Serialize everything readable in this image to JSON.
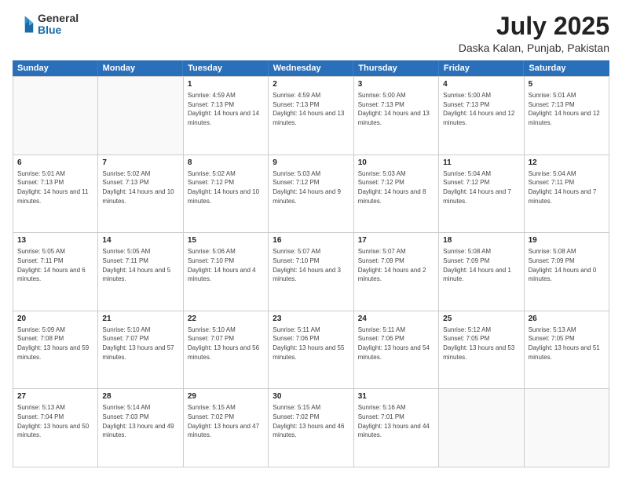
{
  "header": {
    "logo": {
      "general": "General",
      "blue": "Blue"
    },
    "title": "July 2025",
    "location": "Daska Kalan, Punjab, Pakistan"
  },
  "days_of_week": [
    "Sunday",
    "Monday",
    "Tuesday",
    "Wednesday",
    "Thursday",
    "Friday",
    "Saturday"
  ],
  "weeks": [
    [
      {
        "day": "",
        "empty": true
      },
      {
        "day": "",
        "empty": true
      },
      {
        "day": "1",
        "sunrise": "Sunrise: 4:59 AM",
        "sunset": "Sunset: 7:13 PM",
        "daylight": "Daylight: 14 hours and 14 minutes."
      },
      {
        "day": "2",
        "sunrise": "Sunrise: 4:59 AM",
        "sunset": "Sunset: 7:13 PM",
        "daylight": "Daylight: 14 hours and 13 minutes."
      },
      {
        "day": "3",
        "sunrise": "Sunrise: 5:00 AM",
        "sunset": "Sunset: 7:13 PM",
        "daylight": "Daylight: 14 hours and 13 minutes."
      },
      {
        "day": "4",
        "sunrise": "Sunrise: 5:00 AM",
        "sunset": "Sunset: 7:13 PM",
        "daylight": "Daylight: 14 hours and 12 minutes."
      },
      {
        "day": "5",
        "sunrise": "Sunrise: 5:01 AM",
        "sunset": "Sunset: 7:13 PM",
        "daylight": "Daylight: 14 hours and 12 minutes."
      }
    ],
    [
      {
        "day": "6",
        "sunrise": "Sunrise: 5:01 AM",
        "sunset": "Sunset: 7:13 PM",
        "daylight": "Daylight: 14 hours and 11 minutes."
      },
      {
        "day": "7",
        "sunrise": "Sunrise: 5:02 AM",
        "sunset": "Sunset: 7:13 PM",
        "daylight": "Daylight: 14 hours and 10 minutes."
      },
      {
        "day": "8",
        "sunrise": "Sunrise: 5:02 AM",
        "sunset": "Sunset: 7:12 PM",
        "daylight": "Daylight: 14 hours and 10 minutes."
      },
      {
        "day": "9",
        "sunrise": "Sunrise: 5:03 AM",
        "sunset": "Sunset: 7:12 PM",
        "daylight": "Daylight: 14 hours and 9 minutes."
      },
      {
        "day": "10",
        "sunrise": "Sunrise: 5:03 AM",
        "sunset": "Sunset: 7:12 PM",
        "daylight": "Daylight: 14 hours and 8 minutes."
      },
      {
        "day": "11",
        "sunrise": "Sunrise: 5:04 AM",
        "sunset": "Sunset: 7:12 PM",
        "daylight": "Daylight: 14 hours and 7 minutes."
      },
      {
        "day": "12",
        "sunrise": "Sunrise: 5:04 AM",
        "sunset": "Sunset: 7:11 PM",
        "daylight": "Daylight: 14 hours and 7 minutes."
      }
    ],
    [
      {
        "day": "13",
        "sunrise": "Sunrise: 5:05 AM",
        "sunset": "Sunset: 7:11 PM",
        "daylight": "Daylight: 14 hours and 6 minutes."
      },
      {
        "day": "14",
        "sunrise": "Sunrise: 5:05 AM",
        "sunset": "Sunset: 7:11 PM",
        "daylight": "Daylight: 14 hours and 5 minutes."
      },
      {
        "day": "15",
        "sunrise": "Sunrise: 5:06 AM",
        "sunset": "Sunset: 7:10 PM",
        "daylight": "Daylight: 14 hours and 4 minutes."
      },
      {
        "day": "16",
        "sunrise": "Sunrise: 5:07 AM",
        "sunset": "Sunset: 7:10 PM",
        "daylight": "Daylight: 14 hours and 3 minutes."
      },
      {
        "day": "17",
        "sunrise": "Sunrise: 5:07 AM",
        "sunset": "Sunset: 7:09 PM",
        "daylight": "Daylight: 14 hours and 2 minutes."
      },
      {
        "day": "18",
        "sunrise": "Sunrise: 5:08 AM",
        "sunset": "Sunset: 7:09 PM",
        "daylight": "Daylight: 14 hours and 1 minute."
      },
      {
        "day": "19",
        "sunrise": "Sunrise: 5:08 AM",
        "sunset": "Sunset: 7:09 PM",
        "daylight": "Daylight: 14 hours and 0 minutes."
      }
    ],
    [
      {
        "day": "20",
        "sunrise": "Sunrise: 5:09 AM",
        "sunset": "Sunset: 7:08 PM",
        "daylight": "Daylight: 13 hours and 59 minutes."
      },
      {
        "day": "21",
        "sunrise": "Sunrise: 5:10 AM",
        "sunset": "Sunset: 7:07 PM",
        "daylight": "Daylight: 13 hours and 57 minutes."
      },
      {
        "day": "22",
        "sunrise": "Sunrise: 5:10 AM",
        "sunset": "Sunset: 7:07 PM",
        "daylight": "Daylight: 13 hours and 56 minutes."
      },
      {
        "day": "23",
        "sunrise": "Sunrise: 5:11 AM",
        "sunset": "Sunset: 7:06 PM",
        "daylight": "Daylight: 13 hours and 55 minutes."
      },
      {
        "day": "24",
        "sunrise": "Sunrise: 5:11 AM",
        "sunset": "Sunset: 7:06 PM",
        "daylight": "Daylight: 13 hours and 54 minutes."
      },
      {
        "day": "25",
        "sunrise": "Sunrise: 5:12 AM",
        "sunset": "Sunset: 7:05 PM",
        "daylight": "Daylight: 13 hours and 53 minutes."
      },
      {
        "day": "26",
        "sunrise": "Sunrise: 5:13 AM",
        "sunset": "Sunset: 7:05 PM",
        "daylight": "Daylight: 13 hours and 51 minutes."
      }
    ],
    [
      {
        "day": "27",
        "sunrise": "Sunrise: 5:13 AM",
        "sunset": "Sunset: 7:04 PM",
        "daylight": "Daylight: 13 hours and 50 minutes."
      },
      {
        "day": "28",
        "sunrise": "Sunrise: 5:14 AM",
        "sunset": "Sunset: 7:03 PM",
        "daylight": "Daylight: 13 hours and 49 minutes."
      },
      {
        "day": "29",
        "sunrise": "Sunrise: 5:15 AM",
        "sunset": "Sunset: 7:02 PM",
        "daylight": "Daylight: 13 hours and 47 minutes."
      },
      {
        "day": "30",
        "sunrise": "Sunrise: 5:15 AM",
        "sunset": "Sunset: 7:02 PM",
        "daylight": "Daylight: 13 hours and 46 minutes."
      },
      {
        "day": "31",
        "sunrise": "Sunrise: 5:16 AM",
        "sunset": "Sunset: 7:01 PM",
        "daylight": "Daylight: 13 hours and 44 minutes."
      },
      {
        "day": "",
        "empty": true
      },
      {
        "day": "",
        "empty": true
      }
    ]
  ]
}
